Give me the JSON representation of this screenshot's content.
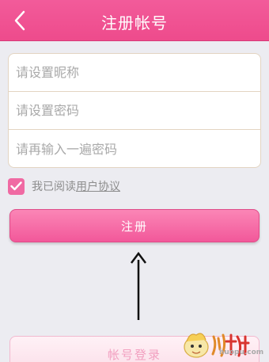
{
  "header": {
    "title": "注册帐号"
  },
  "form": {
    "nickname_placeholder": "请设置昵称",
    "password_placeholder": "请设置密码",
    "confirm_placeholder": "请再输入一遍密码"
  },
  "agreement": {
    "checked": true,
    "text": "我已阅读",
    "link": "用户协议"
  },
  "buttons": {
    "register": "注册",
    "login": "帐号登录"
  },
  "watermark": {
    "url": "huopu.com",
    "logo_text": "火扑"
  },
  "colors": {
    "accent": "#f06aa3",
    "header": "#ee4b8c"
  }
}
